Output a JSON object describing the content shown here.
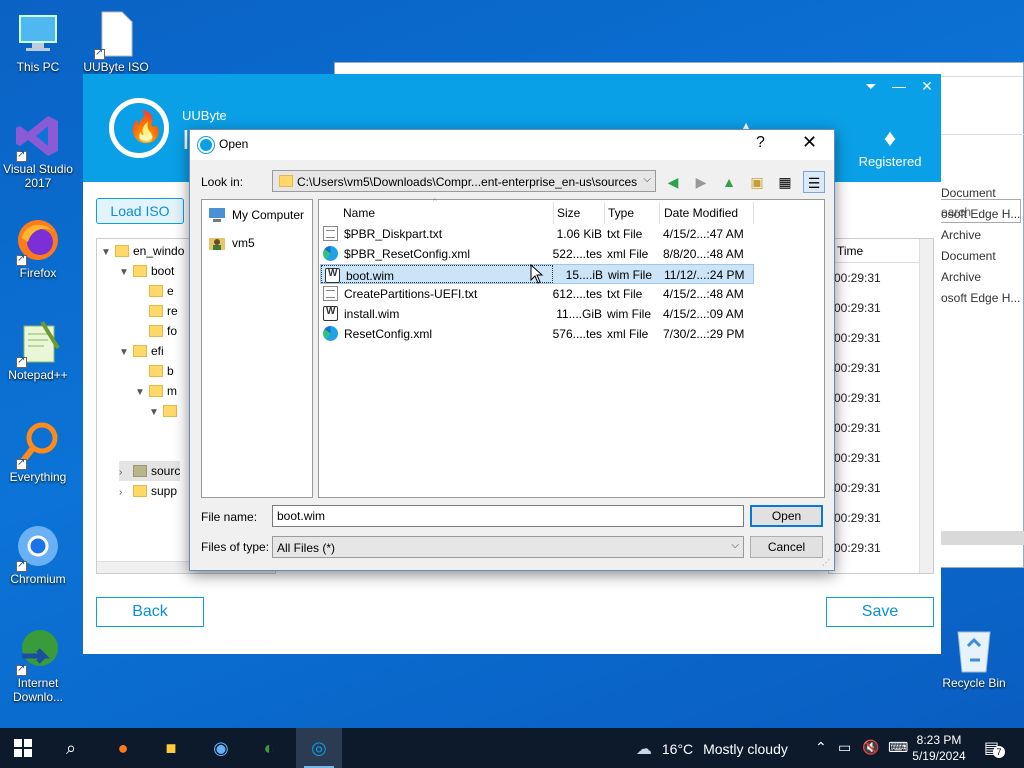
{
  "desktop": {
    "icons": [
      {
        "label": "This PC"
      },
      {
        "label": "UUByte ISO"
      },
      {
        "label": "Visual Studio 2017"
      },
      {
        "label": "Firefox"
      },
      {
        "label": "Notepad++"
      },
      {
        "label": "Everything"
      },
      {
        "label": "Chromium"
      },
      {
        "label": "Internet Downlo..."
      }
    ],
    "recycle_bin": "Recycle Bin"
  },
  "bg_explorer": {
    "search_placeholder": "earch",
    "items": [
      "Document",
      "osoft Edge H...",
      "Archive",
      "Document",
      "Archive",
      "osoft Edge H..."
    ]
  },
  "app": {
    "brand": "UUByte",
    "title_fragment": "I",
    "registered": "Registered",
    "load_iso": "Load ISO",
    "tree": [
      {
        "label": "en_windo",
        "expanded": true
      },
      {
        "label": "boot",
        "expanded": true
      },
      {
        "label": "e"
      },
      {
        "label": "re"
      },
      {
        "label": "fo"
      },
      {
        "label": "efi",
        "expanded": true
      },
      {
        "label": "b"
      },
      {
        "label": "m"
      },
      {
        "label": ""
      },
      {
        "label": "sourc"
      },
      {
        "label": "supp"
      }
    ],
    "list_header": "Time",
    "times": [
      "00:29:31",
      "00:29:31",
      "00:29:31",
      "00:29:31",
      "00:29:31",
      "00:29:31",
      "00:29:31",
      "00:29:31",
      "00:29:31",
      "00:29:31"
    ],
    "back": "Back",
    "save": "Save"
  },
  "dialog": {
    "title": "Open",
    "help": "?",
    "look_in_label": "Look in:",
    "look_in_path": "C:\\Users\\vm5\\Downloads\\Compr...ent-enterprise_en-us\\sources",
    "places": [
      "My Computer",
      "vm5"
    ],
    "columns": {
      "name": "Name",
      "size": "Size",
      "type": "Type",
      "date": "Date Modified"
    },
    "files": [
      {
        "name": "$PBR_Diskpart.txt",
        "size": "1.06 KiB",
        "type": "txt File",
        "date": "4/15/2...:47 AM",
        "icon": "txt"
      },
      {
        "name": "$PBR_ResetConfig.xml",
        "size": "522....tes",
        "type": "xml File",
        "date": "8/8/20...:48 AM",
        "icon": "xml"
      },
      {
        "name": "boot.wim",
        "size": "15....iB",
        "type": "wim File",
        "date": "11/12/...:24 PM",
        "icon": "wim",
        "selected": true
      },
      {
        "name": "CreatePartitions-UEFI.txt",
        "size": "612....tes",
        "type": "txt File",
        "date": "4/15/2...:48 AM",
        "icon": "txt"
      },
      {
        "name": "install.wim",
        "size": "11....GiB",
        "type": "wim File",
        "date": "4/15/2...:09 AM",
        "icon": "wim"
      },
      {
        "name": "ResetConfig.xml",
        "size": "576....tes",
        "type": "xml File",
        "date": "7/30/2...:29 PM",
        "icon": "xml"
      }
    ],
    "file_name_label": "File name:",
    "file_name_value": "boot.wim",
    "file_type_label": "Files of type:",
    "file_type_value": "All Files (*)",
    "open": "Open",
    "cancel": "Cancel"
  },
  "taskbar": {
    "weather_temp": "16°C",
    "weather_text": "Mostly cloudy",
    "time": "8:23 PM",
    "date": "5/19/2024",
    "notifications": "7"
  },
  "colors": {
    "desktop": "#0b74d6",
    "app_accent": "#0aa0e8",
    "taskbar": "#0c1a2c",
    "selection": "#cce4f7"
  }
}
